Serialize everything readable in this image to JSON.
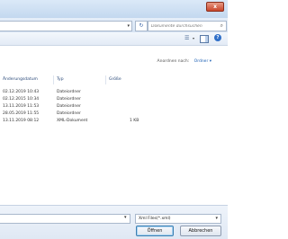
{
  "title_bar": {
    "close_label": "x"
  },
  "address_bar": {
    "refresh_icon": "refresh-icon",
    "search_placeholder": "Dokumente durchsuchen"
  },
  "toolbar": {
    "view_icon": "view-options-icon",
    "view_dropdown": "▾"
  },
  "arrange": {
    "label": "Anordnen nach:",
    "value": "Ordner ▾"
  },
  "columns": {
    "date": "Änderungsdatum",
    "type": "Typ",
    "size": "Größe"
  },
  "files": [
    {
      "date": "02.12.2019 10:43",
      "type": "Dateiordner",
      "size": ""
    },
    {
      "date": "02.12.2015 10:34",
      "type": "Dateiordner",
      "size": ""
    },
    {
      "date": "13.11.2019 11:53",
      "type": "Dateiordner",
      "size": ""
    },
    {
      "date": "28.05.2019 11:55",
      "type": "Dateiordner",
      "size": ""
    },
    {
      "date": "13.11.2019 08:12",
      "type": "XML-Dokument",
      "size": "1 KB"
    }
  ],
  "footer": {
    "filetype_value": "Xml Files(*.xml)",
    "open_label": "Öffnen",
    "cancel_label": "Abbrechen"
  }
}
